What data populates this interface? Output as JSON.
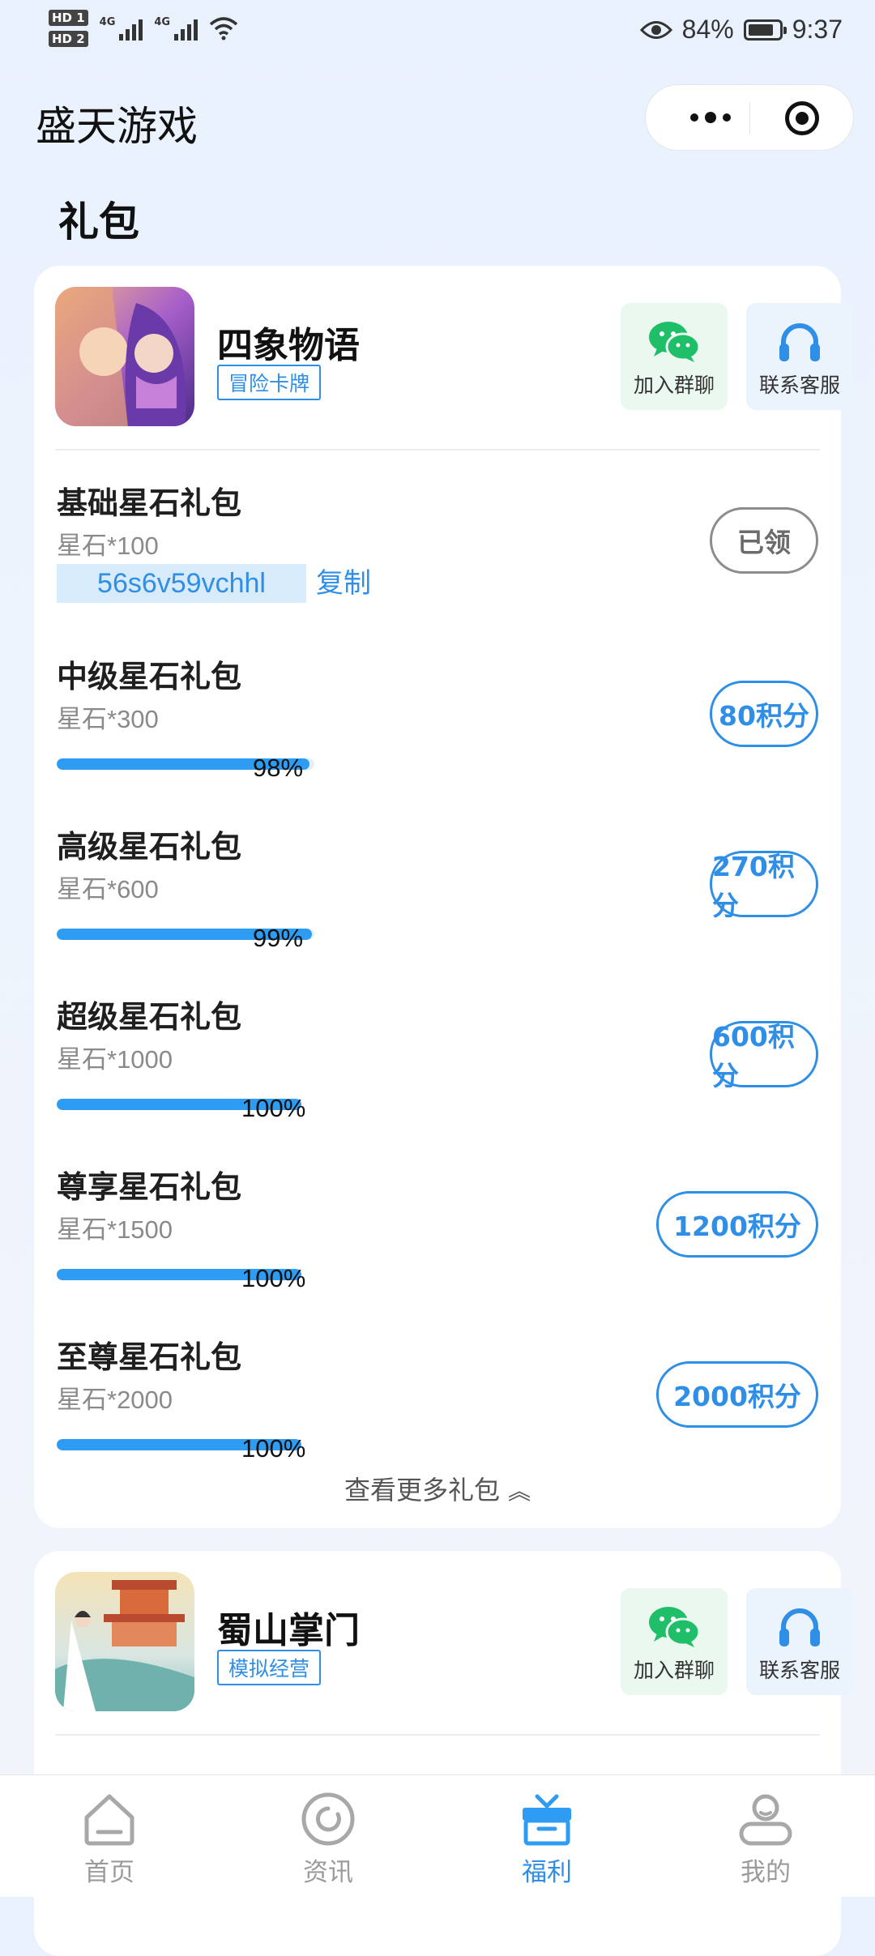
{
  "status_bar": {
    "sim1": "HD 1",
    "sim2": "HD 2",
    "net1": "4G",
    "net2": "4G",
    "battery": "84%",
    "time": "9:37"
  },
  "header": {
    "app_title": "盛天游戏"
  },
  "section_title": "礼包",
  "colors": {
    "accent": "#2f8ee6",
    "wechat": "#1fbf6a",
    "progress": "#2f9cf4"
  },
  "games": [
    {
      "name": "四象物语",
      "tag": "冒险卡牌",
      "join_label": "加入群聊",
      "service_label": "联系客服",
      "gifts": [
        {
          "name": "基础星石礼包",
          "desc": "星石*100",
          "code": "56s6v59vchhl",
          "copy_label": "复制",
          "button": "已领"
        },
        {
          "name": "中级星石礼包",
          "desc": "星石*300",
          "progress": 98,
          "progress_text": "98%",
          "button": "80积分"
        },
        {
          "name": "高级星石礼包",
          "desc": "星石*600",
          "progress": 99,
          "progress_text": "99%",
          "button": "270积分"
        },
        {
          "name": "超级星石礼包",
          "desc": "星石*1000",
          "progress": 100,
          "progress_text": "100%",
          "button": "600积分"
        },
        {
          "name": "尊享星石礼包",
          "desc": "星石*1500",
          "progress": 100,
          "progress_text": "100%",
          "button": "1200积分"
        },
        {
          "name": "至尊星石礼包",
          "desc": "星石*2000",
          "progress": 100,
          "progress_text": "100%",
          "button": "2000积分"
        }
      ],
      "more_label": "查看更多礼包"
    },
    {
      "name": "蜀山掌门",
      "tag": "模拟经营",
      "join_label": "加入群聊",
      "service_label": "联系客服"
    }
  ],
  "bottom_nav": [
    {
      "label": "首页",
      "icon": "home-icon"
    },
    {
      "label": "资讯",
      "icon": "news-icon"
    },
    {
      "label": "福利",
      "icon": "gift-icon",
      "active": true
    },
    {
      "label": "我的",
      "icon": "profile-icon"
    }
  ]
}
